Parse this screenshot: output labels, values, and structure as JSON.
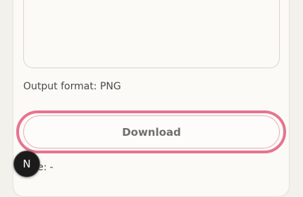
{
  "output": {
    "format_label": "Output format: PNG"
  },
  "download": {
    "label": "Download"
  },
  "size": {
    "label": "Size:",
    "value": "-"
  },
  "badge": {
    "letter": "N",
    "icon": "nextjs-logo-icon"
  },
  "colors": {
    "focus_ring": "#e7738f",
    "button_text": "#6f6f6f",
    "card_background": "#fbfaf6"
  }
}
